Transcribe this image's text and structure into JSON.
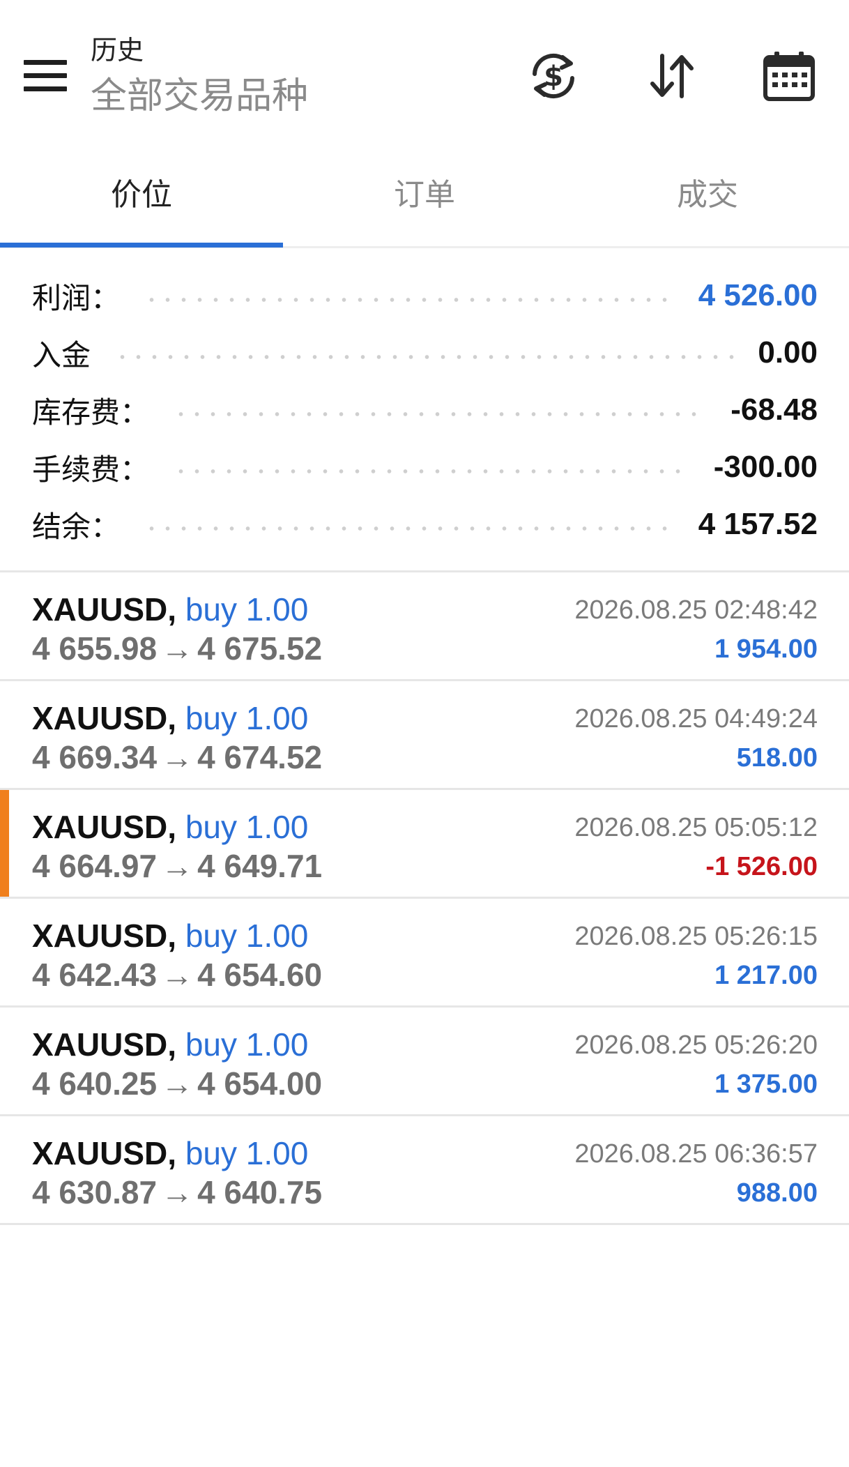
{
  "header": {
    "title": "历史",
    "subtitle": "全部交易品种",
    "icons": [
      "menu-icon",
      "currency-refresh-icon",
      "sort-icon",
      "calendar-icon"
    ]
  },
  "tabs": [
    {
      "label": "价位",
      "active": true
    },
    {
      "label": "订单",
      "active": false
    },
    {
      "label": "成交",
      "active": false
    }
  ],
  "summary": [
    {
      "label": "利润：",
      "value": "4 526.00",
      "color": "#2a6fd6"
    },
    {
      "label": "入金",
      "value": "0.00",
      "color": "#111111"
    },
    {
      "label": "库存费：",
      "value": "-68.48",
      "color": "#111111"
    },
    {
      "label": "手续费：",
      "value": "-300.00",
      "color": "#111111"
    },
    {
      "label": "结余：",
      "value": "4 157.52",
      "color": "#111111"
    }
  ],
  "trades": [
    {
      "symbol": "XAUUSD,",
      "side": "buy 1.00",
      "open": "4 655.98",
      "arrow": "→",
      "close": "4 675.52",
      "time": "2026.08.25 02:48:42",
      "profit": "1 954.00",
      "negative": false,
      "highlighted": false
    },
    {
      "symbol": "XAUUSD,",
      "side": "buy 1.00",
      "open": "4 669.34",
      "arrow": "→",
      "close": "4 674.52",
      "time": "2026.08.25 04:49:24",
      "profit": "518.00",
      "negative": false,
      "highlighted": false
    },
    {
      "symbol": "XAUUSD,",
      "side": "buy 1.00",
      "open": "4 664.97",
      "arrow": "→",
      "close": "4 649.71",
      "time": "2026.08.25 05:05:12",
      "profit": "-1 526.00",
      "negative": true,
      "highlighted": true
    },
    {
      "symbol": "XAUUSD,",
      "side": "buy 1.00",
      "open": "4 642.43",
      "arrow": "→",
      "close": "4 654.60",
      "time": "2026.08.25 05:26:15",
      "profit": "1 217.00",
      "negative": false,
      "highlighted": false
    },
    {
      "symbol": "XAUUSD,",
      "side": "buy 1.00",
      "open": "4 640.25",
      "arrow": "→",
      "close": "4 654.00",
      "time": "2026.08.25 05:26:20",
      "profit": "1 375.00",
      "negative": false,
      "highlighted": false
    },
    {
      "symbol": "XAUUSD,",
      "side": "buy 1.00",
      "open": "4 630.87",
      "arrow": "→",
      "close": "4 640.75",
      "time": "2026.08.25 06:36:57",
      "profit": "988.00",
      "negative": false,
      "highlighted": false
    }
  ],
  "colors": {
    "accent": "#2a6fd6",
    "negative": "#c6141b",
    "highlight_marker": "#f07f1d"
  }
}
